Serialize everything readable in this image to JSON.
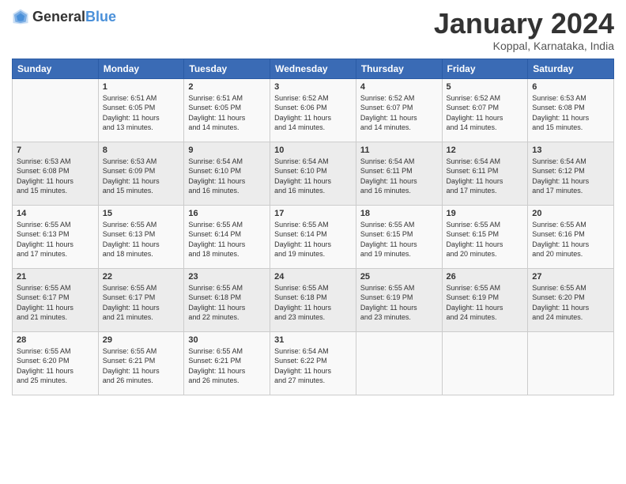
{
  "logo": {
    "general": "General",
    "blue": "Blue"
  },
  "title": "January 2024",
  "location": "Koppal, Karnataka, India",
  "weekdays": [
    "Sunday",
    "Monday",
    "Tuesday",
    "Wednesday",
    "Thursday",
    "Friday",
    "Saturday"
  ],
  "weeks": [
    [
      {
        "day": "",
        "info": ""
      },
      {
        "day": "1",
        "info": "Sunrise: 6:51 AM\nSunset: 6:05 PM\nDaylight: 11 hours\nand 13 minutes."
      },
      {
        "day": "2",
        "info": "Sunrise: 6:51 AM\nSunset: 6:05 PM\nDaylight: 11 hours\nand 14 minutes."
      },
      {
        "day": "3",
        "info": "Sunrise: 6:52 AM\nSunset: 6:06 PM\nDaylight: 11 hours\nand 14 minutes."
      },
      {
        "day": "4",
        "info": "Sunrise: 6:52 AM\nSunset: 6:07 PM\nDaylight: 11 hours\nand 14 minutes."
      },
      {
        "day": "5",
        "info": "Sunrise: 6:52 AM\nSunset: 6:07 PM\nDaylight: 11 hours\nand 14 minutes."
      },
      {
        "day": "6",
        "info": "Sunrise: 6:53 AM\nSunset: 6:08 PM\nDaylight: 11 hours\nand 15 minutes."
      }
    ],
    [
      {
        "day": "7",
        "info": "Sunrise: 6:53 AM\nSunset: 6:08 PM\nDaylight: 11 hours\nand 15 minutes."
      },
      {
        "day": "8",
        "info": "Sunrise: 6:53 AM\nSunset: 6:09 PM\nDaylight: 11 hours\nand 15 minutes."
      },
      {
        "day": "9",
        "info": "Sunrise: 6:54 AM\nSunset: 6:10 PM\nDaylight: 11 hours\nand 16 minutes."
      },
      {
        "day": "10",
        "info": "Sunrise: 6:54 AM\nSunset: 6:10 PM\nDaylight: 11 hours\nand 16 minutes."
      },
      {
        "day": "11",
        "info": "Sunrise: 6:54 AM\nSunset: 6:11 PM\nDaylight: 11 hours\nand 16 minutes."
      },
      {
        "day": "12",
        "info": "Sunrise: 6:54 AM\nSunset: 6:11 PM\nDaylight: 11 hours\nand 17 minutes."
      },
      {
        "day": "13",
        "info": "Sunrise: 6:54 AM\nSunset: 6:12 PM\nDaylight: 11 hours\nand 17 minutes."
      }
    ],
    [
      {
        "day": "14",
        "info": "Sunrise: 6:55 AM\nSunset: 6:13 PM\nDaylight: 11 hours\nand 17 minutes."
      },
      {
        "day": "15",
        "info": "Sunrise: 6:55 AM\nSunset: 6:13 PM\nDaylight: 11 hours\nand 18 minutes."
      },
      {
        "day": "16",
        "info": "Sunrise: 6:55 AM\nSunset: 6:14 PM\nDaylight: 11 hours\nand 18 minutes."
      },
      {
        "day": "17",
        "info": "Sunrise: 6:55 AM\nSunset: 6:14 PM\nDaylight: 11 hours\nand 19 minutes."
      },
      {
        "day": "18",
        "info": "Sunrise: 6:55 AM\nSunset: 6:15 PM\nDaylight: 11 hours\nand 19 minutes."
      },
      {
        "day": "19",
        "info": "Sunrise: 6:55 AM\nSunset: 6:15 PM\nDaylight: 11 hours\nand 20 minutes."
      },
      {
        "day": "20",
        "info": "Sunrise: 6:55 AM\nSunset: 6:16 PM\nDaylight: 11 hours\nand 20 minutes."
      }
    ],
    [
      {
        "day": "21",
        "info": "Sunrise: 6:55 AM\nSunset: 6:17 PM\nDaylight: 11 hours\nand 21 minutes."
      },
      {
        "day": "22",
        "info": "Sunrise: 6:55 AM\nSunset: 6:17 PM\nDaylight: 11 hours\nand 21 minutes."
      },
      {
        "day": "23",
        "info": "Sunrise: 6:55 AM\nSunset: 6:18 PM\nDaylight: 11 hours\nand 22 minutes."
      },
      {
        "day": "24",
        "info": "Sunrise: 6:55 AM\nSunset: 6:18 PM\nDaylight: 11 hours\nand 23 minutes."
      },
      {
        "day": "25",
        "info": "Sunrise: 6:55 AM\nSunset: 6:19 PM\nDaylight: 11 hours\nand 23 minutes."
      },
      {
        "day": "26",
        "info": "Sunrise: 6:55 AM\nSunset: 6:19 PM\nDaylight: 11 hours\nand 24 minutes."
      },
      {
        "day": "27",
        "info": "Sunrise: 6:55 AM\nSunset: 6:20 PM\nDaylight: 11 hours\nand 24 minutes."
      }
    ],
    [
      {
        "day": "28",
        "info": "Sunrise: 6:55 AM\nSunset: 6:20 PM\nDaylight: 11 hours\nand 25 minutes."
      },
      {
        "day": "29",
        "info": "Sunrise: 6:55 AM\nSunset: 6:21 PM\nDaylight: 11 hours\nand 26 minutes."
      },
      {
        "day": "30",
        "info": "Sunrise: 6:55 AM\nSunset: 6:21 PM\nDaylight: 11 hours\nand 26 minutes."
      },
      {
        "day": "31",
        "info": "Sunrise: 6:54 AM\nSunset: 6:22 PM\nDaylight: 11 hours\nand 27 minutes."
      },
      {
        "day": "",
        "info": ""
      },
      {
        "day": "",
        "info": ""
      },
      {
        "day": "",
        "info": ""
      }
    ]
  ]
}
